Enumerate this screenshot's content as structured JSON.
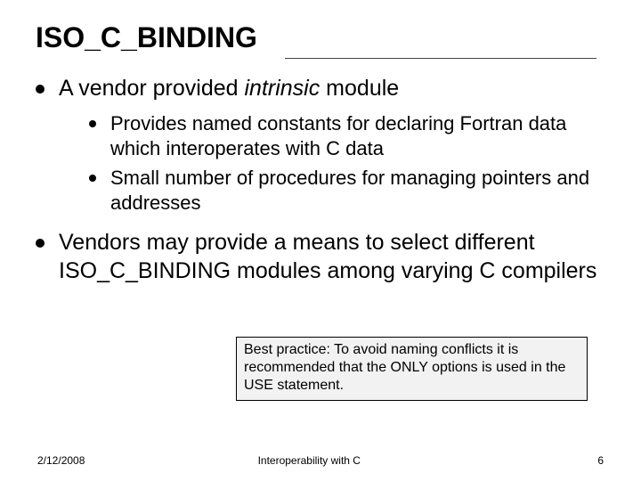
{
  "title": "ISO_C_BINDING",
  "b1_pre": "A vendor provided ",
  "b1_em": "intrinsic",
  "b1_post": " module",
  "sub1": "Provides named constants for declaring Fortran data which interoperates with C data",
  "sub2": "Small number of procedures for managing pointers and addresses",
  "b2": "Vendors may provide a means to select different ISO_C_BINDING modules among varying C compilers",
  "callout": "Best practice: To avoid naming conflicts it is recommended that the ONLY options is used in the USE statement.",
  "footer": {
    "date": "2/12/2008",
    "mid": "Interoperability with C",
    "num": "6"
  }
}
